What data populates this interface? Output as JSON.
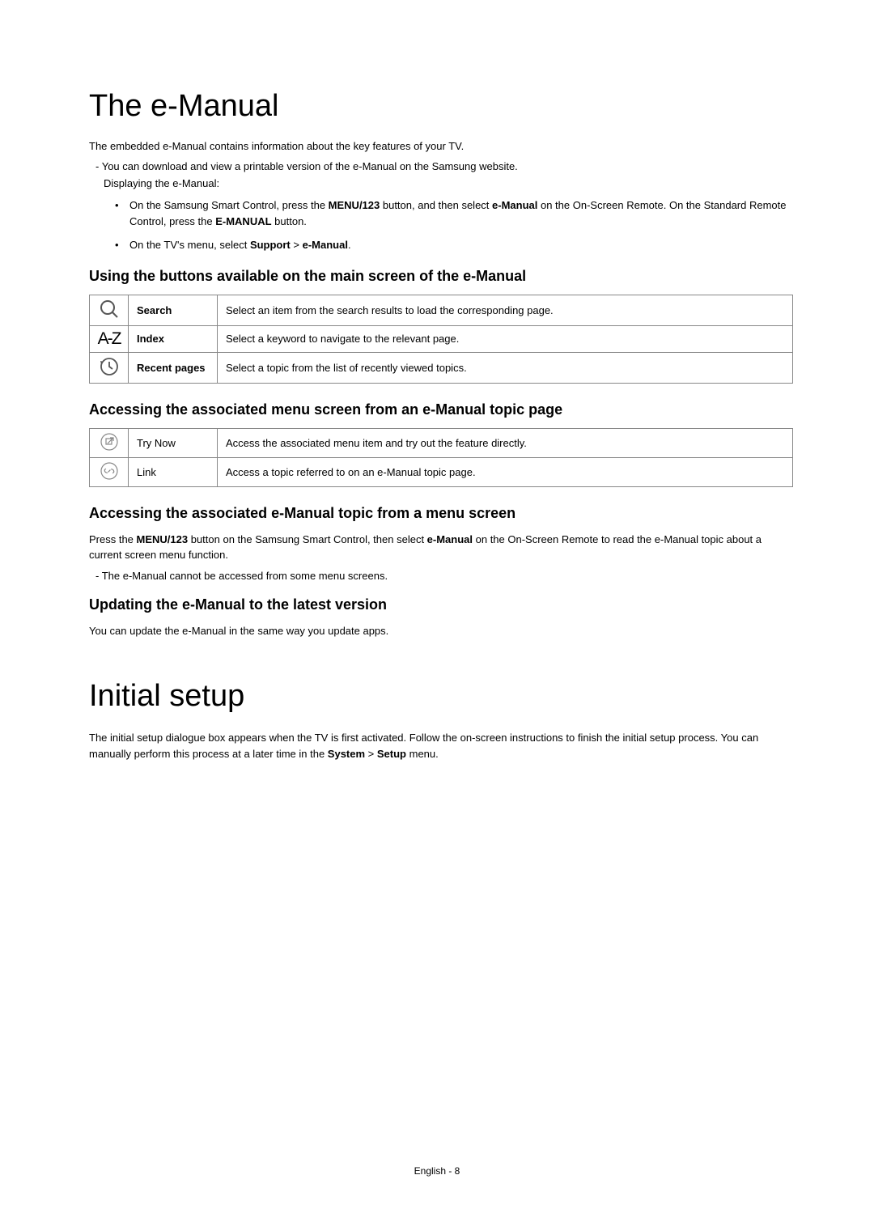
{
  "section1": {
    "title": "The e-Manual",
    "intro": "The embedded e-Manual contains information about the key features of your TV.",
    "dash1": "You can download and view a printable version of the e-Manual on the Samsung website.",
    "displaying": "Displaying the e-Manual:",
    "bullet1_pre": "On the Samsung Smart Control, press the ",
    "bullet1_bold1": "MENU/123",
    "bullet1_mid": " button, and then select ",
    "bullet1_bold2": "e-Manual",
    "bullet1_post": " on the On-Screen Remote. On the Standard Remote Control, press the ",
    "bullet1_bold3": "E-MANUAL",
    "bullet1_end": " button.",
    "bullet2_pre": "On the TV's menu, select ",
    "bullet2_bold1": "Support",
    "bullet2_gt": " > ",
    "bullet2_bold2": "e-Manual",
    "bullet2_end": ".",
    "h2a": "Using the buttons available on the main screen of the e-Manual",
    "table1": {
      "r1": {
        "name": "Search",
        "desc": "Select an item from the search results to load the corresponding page."
      },
      "r2": {
        "name": "Index",
        "desc": "Select a keyword to navigate to the relevant page.",
        "icon": "A-Z"
      },
      "r3": {
        "name": "Recent pages",
        "desc": "Select a topic from the list of recently viewed topics."
      }
    },
    "h2b": "Accessing the associated menu screen from an e-Manual topic page",
    "table2": {
      "r1": {
        "name": "Try Now",
        "desc": "Access the associated menu item and try out the feature directly."
      },
      "r2": {
        "name": "Link",
        "desc": "Access a topic referred to on an e-Manual topic page."
      }
    },
    "h2c": "Accessing the associated e-Manual topic from a menu screen",
    "p1_pre": "Press the ",
    "p1_bold1": "MENU/123",
    "p1_mid": " button on the Samsung Smart Control, then select ",
    "p1_bold2": "e-Manual",
    "p1_post": " on the On-Screen Remote to read the e-Manual topic about a current screen menu function.",
    "dash2": "The e-Manual cannot be accessed from some menu screens.",
    "h2d": "Updating the e-Manual to the latest version",
    "p2": "You can update the e-Manual in the same way you update apps."
  },
  "section2": {
    "title": "Initial setup",
    "p_pre": "The initial setup dialogue box appears when the TV is first activated. Follow the on-screen instructions to finish the initial setup process. You can manually perform this process at a later time in the ",
    "p_bold1": "System",
    "p_gt": " > ",
    "p_bold2": "Setup",
    "p_end": " menu."
  },
  "footer": "English - 8"
}
